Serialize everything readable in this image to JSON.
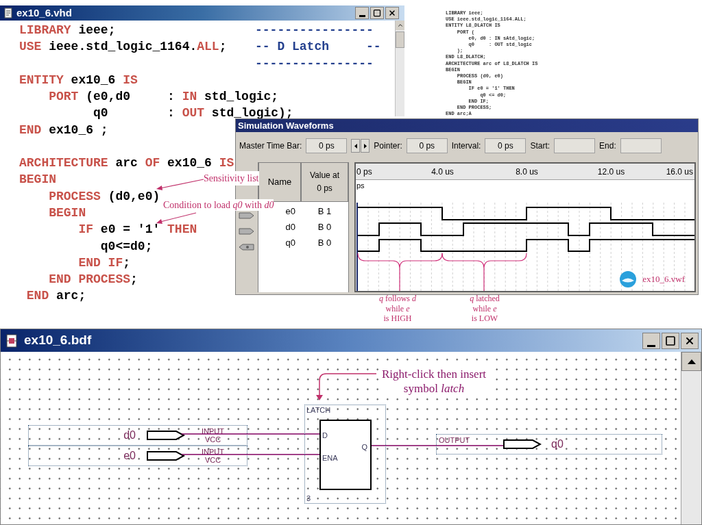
{
  "vhd_window": {
    "title": "ex10_6.vhd",
    "blocks": [
      [
        {
          "tokens": [
            {
              "text": "LIBRARY",
              "kind": "keyword"
            },
            {
              "text": " ieee;",
              "kind": "plain"
            }
          ],
          "comment": "----------------"
        },
        {
          "tokens": [
            {
              "text": "USE",
              "kind": "keyword"
            },
            {
              "text": " ieee.std_logic_1164.",
              "kind": "plain"
            },
            {
              "text": "ALL",
              "kind": "keyword"
            },
            {
              "text": ";",
              "kind": "plain"
            }
          ],
          "comment": "-- D Latch     --"
        },
        {
          "comment": "----------------"
        },
        {
          "tokens": [
            {
              "text": "ENTITY",
              "kind": "keyword"
            },
            {
              "text": " ex10_6 ",
              "kind": "plain"
            },
            {
              "text": "IS",
              "kind": "keyword"
            }
          ]
        },
        {
          "tokens": [
            {
              "text": "    PORT",
              "kind": "keyword"
            },
            {
              "text": " (e0,d0     : ",
              "kind": "plain"
            },
            {
              "text": "IN",
              "kind": "keyword"
            },
            {
              "text": " std_logic;",
              "kind": "plain"
            }
          ]
        },
        {
          "tokens": [
            {
              "text": "          q0        : ",
              "kind": "plain"
            },
            {
              "text": "OUT",
              "kind": "keyword"
            },
            {
              "text": " std_logic);",
              "kind": "plain"
            }
          ]
        },
        {
          "tokens": [
            {
              "text": "END",
              "kind": "keyword"
            },
            {
              "text": " ex10_6 ;",
              "kind": "plain"
            }
          ]
        }
      ],
      [
        {
          "tokens": [
            {
              "text": "ARCHITECTURE",
              "kind": "keyword"
            },
            {
              "text": " arc ",
              "kind": "plain"
            },
            {
              "text": "OF",
              "kind": "keyword"
            },
            {
              "text": " ex10_6 ",
              "kind": "plain"
            },
            {
              "text": "IS",
              "kind": "keyword"
            }
          ]
        },
        {
          "tokens": [
            {
              "text": "BEGIN",
              "kind": "keyword"
            }
          ]
        },
        {
          "tokens": [
            {
              "text": "    PROCESS",
              "kind": "keyword"
            },
            {
              "text": " (d0,e0)",
              "kind": "plain"
            }
          ]
        },
        {
          "tokens": [
            {
              "text": "    BEGIN",
              "kind": "keyword"
            }
          ]
        },
        {
          "tokens": [
            {
              "text": "        IF",
              "kind": "keyword"
            },
            {
              "text": " e0 = '1' ",
              "kind": "plain"
            },
            {
              "text": "THEN",
              "kind": "keyword"
            }
          ]
        },
        {
          "tokens": [
            {
              "text": "           q0<=d0;",
              "kind": "plain"
            }
          ]
        },
        {
          "tokens": [
            {
              "text": "        END IF",
              "kind": "keyword"
            },
            {
              "text": ";",
              "kind": "plain"
            }
          ]
        },
        {
          "tokens": [
            {
              "text": "    END PROCESS",
              "kind": "keyword"
            },
            {
              "text": ";",
              "kind": "plain"
            }
          ]
        },
        {
          "tokens": [
            {
              "text": " END",
              "kind": "keyword"
            },
            {
              "text": " arc;",
              "kind": "plain"
            }
          ]
        }
      ]
    ],
    "annotations": [
      "Sensitivity list",
      "Condition to load *q0* with *d0*"
    ]
  },
  "reference_code": [
    "LIBRARY ieee;",
    "USE ieee.std_logic_1164.ALL;",
    "ENTITY L8_DLATCH IS",
    "    PORT (",
    "        e0, d0 : IN sAtd_logic;",
    "        q0     : OUT std_logic",
    "    );",
    "END L8_DLATCH;",
    "ARCHITECTURE arc of L8_DLATCH IS",
    "BEGIN",
    "    PROCESS (d0, e0)",
    "    BEGIN",
    "        IF e0 = '1' THEN",
    "            q0 <= d0;",
    "        END IF;",
    "    END PROCESS;",
    "END arc;A"
  ],
  "simulation_window": {
    "title": "Simulation Waveforms",
    "toolbar": [
      {
        "kind": "field",
        "label": "Master Time Bar:",
        "value": "0 ps"
      },
      {
        "kind": "stepper"
      },
      {
        "kind": "field",
        "label": "Pointer:",
        "value": "0 ps"
      },
      {
        "kind": "field",
        "label": "Interval:",
        "value": "0 ps"
      },
      {
        "kind": "field",
        "label": "Start:"
      },
      {
        "kind": "field",
        "label": "End:"
      }
    ],
    "columns": [
      "Name",
      "Value at 0 ps"
    ],
    "timeline": [
      "0 ps",
      "4.0 us",
      "8.0 us",
      "12.0 us",
      "16.0 us"
    ],
    "timeline_sub": "ps",
    "signals": [
      {
        "name": "e0",
        "value": "B 1",
        "kind": "input"
      },
      {
        "name": "d0",
        "value": "B 0",
        "kind": "input"
      },
      {
        "name": "q0",
        "value": "B 0",
        "kind": "output"
      }
    ],
    "file": "ex10_6.vwf",
    "annotations": [
      [
        "*q* follows *d*",
        "while *e*",
        "is HIGH"
      ],
      [
        "*q* latched",
        "while *e*",
        "is LOW"
      ]
    ]
  },
  "bdf_window": {
    "title": "ex10_6.bdf",
    "callout": [
      "Right-click then insert",
      "symbol *latch*"
    ],
    "input_pins": [
      {
        "name": "d0",
        "type": "INPUT",
        "default": "VCC"
      },
      {
        "name": "e0",
        "type": "INPUT",
        "default": "VCC"
      }
    ],
    "latch": {
      "title": "LATCH",
      "inputs": [
        "D",
        "ENA"
      ],
      "output": "Q",
      "instance": "3"
    },
    "output_pin": {
      "type": "OUTPUT",
      "name": "q0"
    }
  }
}
